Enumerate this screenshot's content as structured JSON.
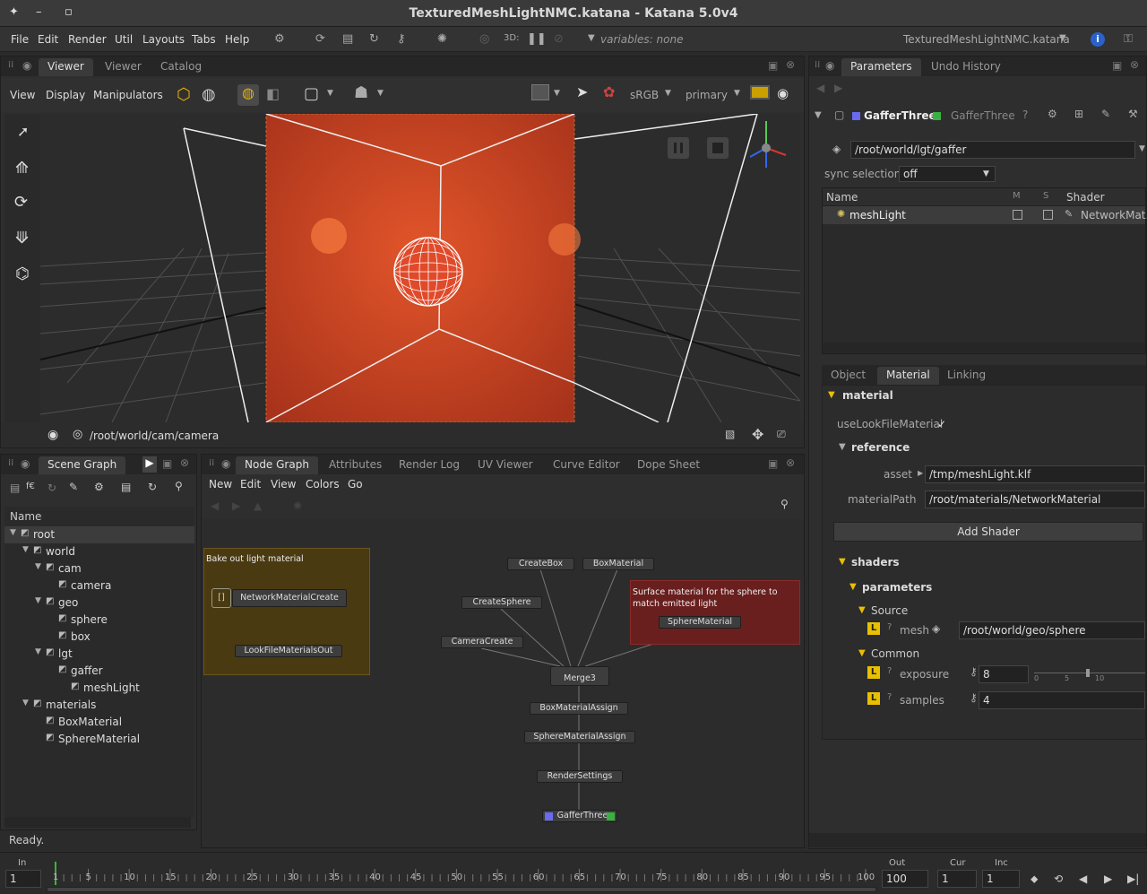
{
  "window": {
    "title": "TexturedMeshLightNMC.katana - Katana 5.0v4"
  },
  "menu": {
    "items": [
      "File",
      "Edit",
      "Render",
      "Util",
      "Layouts",
      "Tabs",
      "Help"
    ],
    "mode_3d": "3D:",
    "variables": "variables: none",
    "project": "TexturedMeshLightNMC.katana"
  },
  "viewer": {
    "tabs": [
      "Viewer",
      "Viewer",
      "Catalog"
    ],
    "menus": [
      "View",
      "Display",
      "Manipulators"
    ],
    "colorspace": "sRGB",
    "display": "primary",
    "camera_path": "/root/world/cam/camera"
  },
  "scene_graph": {
    "tab": "Scene Graph",
    "name_header": "Name",
    "items": [
      {
        "label": "root",
        "level": 0
      },
      {
        "label": "world",
        "level": 1
      },
      {
        "label": "cam",
        "level": 2
      },
      {
        "label": "camera",
        "level": 3
      },
      {
        "label": "geo",
        "level": 2
      },
      {
        "label": "sphere",
        "level": 3
      },
      {
        "label": "box",
        "level": 3
      },
      {
        "label": "lgt",
        "level": 2
      },
      {
        "label": "gaffer",
        "level": 3
      },
      {
        "label": "meshLight",
        "level": 4
      },
      {
        "label": "materials",
        "level": 1
      },
      {
        "label": "BoxMaterial",
        "level": 2
      },
      {
        "label": "SphereMaterial",
        "level": 2
      }
    ],
    "status": "Ready."
  },
  "node_graph": {
    "tabs": [
      "Node Graph",
      "Attributes",
      "Render Log",
      "UV Viewer",
      "Curve Editor",
      "Dope Sheet"
    ],
    "menus": [
      "New",
      "Edit",
      "View",
      "Colors",
      "Go"
    ],
    "backdrop1": "Bake out light material",
    "backdrop2": "Surface material for the sphere to match emitted light",
    "nodes": {
      "nmc": "NetworkMaterialCreate",
      "lfmo": "LookFileMaterialsOut",
      "createbox": "CreateBox",
      "boxmaterial": "BoxMaterial",
      "createsphere": "CreateSphere",
      "spherematerial": "SphereMaterial",
      "cameracreate": "CameraCreate",
      "merge": "Merge3",
      "boxassign": "BoxMaterialAssign",
      "sphereassign": "SphereMaterialAssign",
      "rendersettings": "RenderSettings",
      "gaffer": "GafferThree"
    }
  },
  "params": {
    "tabs": [
      "Parameters",
      "Undo History"
    ],
    "node_name": "GafferThree",
    "node_type": "GafferThree",
    "location": "/root/world/lgt/gaffer",
    "sync_label": "sync selection",
    "sync_value": "off",
    "cols": {
      "name": "Name",
      "m": "M",
      "s": "S",
      "shader": "Shader"
    },
    "row": {
      "name": "meshLight",
      "shader": "NetworkMat..."
    },
    "subtabs": [
      "Object",
      "Material",
      "Linking"
    ],
    "material": "material",
    "use_look": "useLookFileMaterial",
    "use_look_check": "✓",
    "reference": "reference",
    "asset_label": "asset",
    "asset_value": "/tmp/meshLight.klf",
    "matpath_label": "materialPath",
    "matpath_value": "/root/materials/NetworkMaterial",
    "add_shader": "Add Shader",
    "shaders": "shaders",
    "parameters": "parameters",
    "source": "Source",
    "mesh_label": "mesh",
    "mesh_value": "/root/world/geo/sphere",
    "common": "Common",
    "exposure_label": "exposure",
    "exposure_value": "8",
    "samples_label": "samples",
    "samples_value": "4",
    "slider_ticks": [
      "0",
      "5",
      "10"
    ]
  },
  "timeline": {
    "in_label": "In",
    "in_value": "1",
    "out_label": "Out",
    "out_value": "100",
    "cur_label": "Cur",
    "cur_value": "1",
    "inc_label": "Inc",
    "inc_value": "1",
    "ticks": [
      "1",
      "5",
      "10",
      "15",
      "20",
      "25",
      "30",
      "35",
      "40",
      "45",
      "50",
      "55",
      "60",
      "65",
      "70",
      "75",
      "80",
      "85",
      "90",
      "95",
      "100"
    ]
  }
}
